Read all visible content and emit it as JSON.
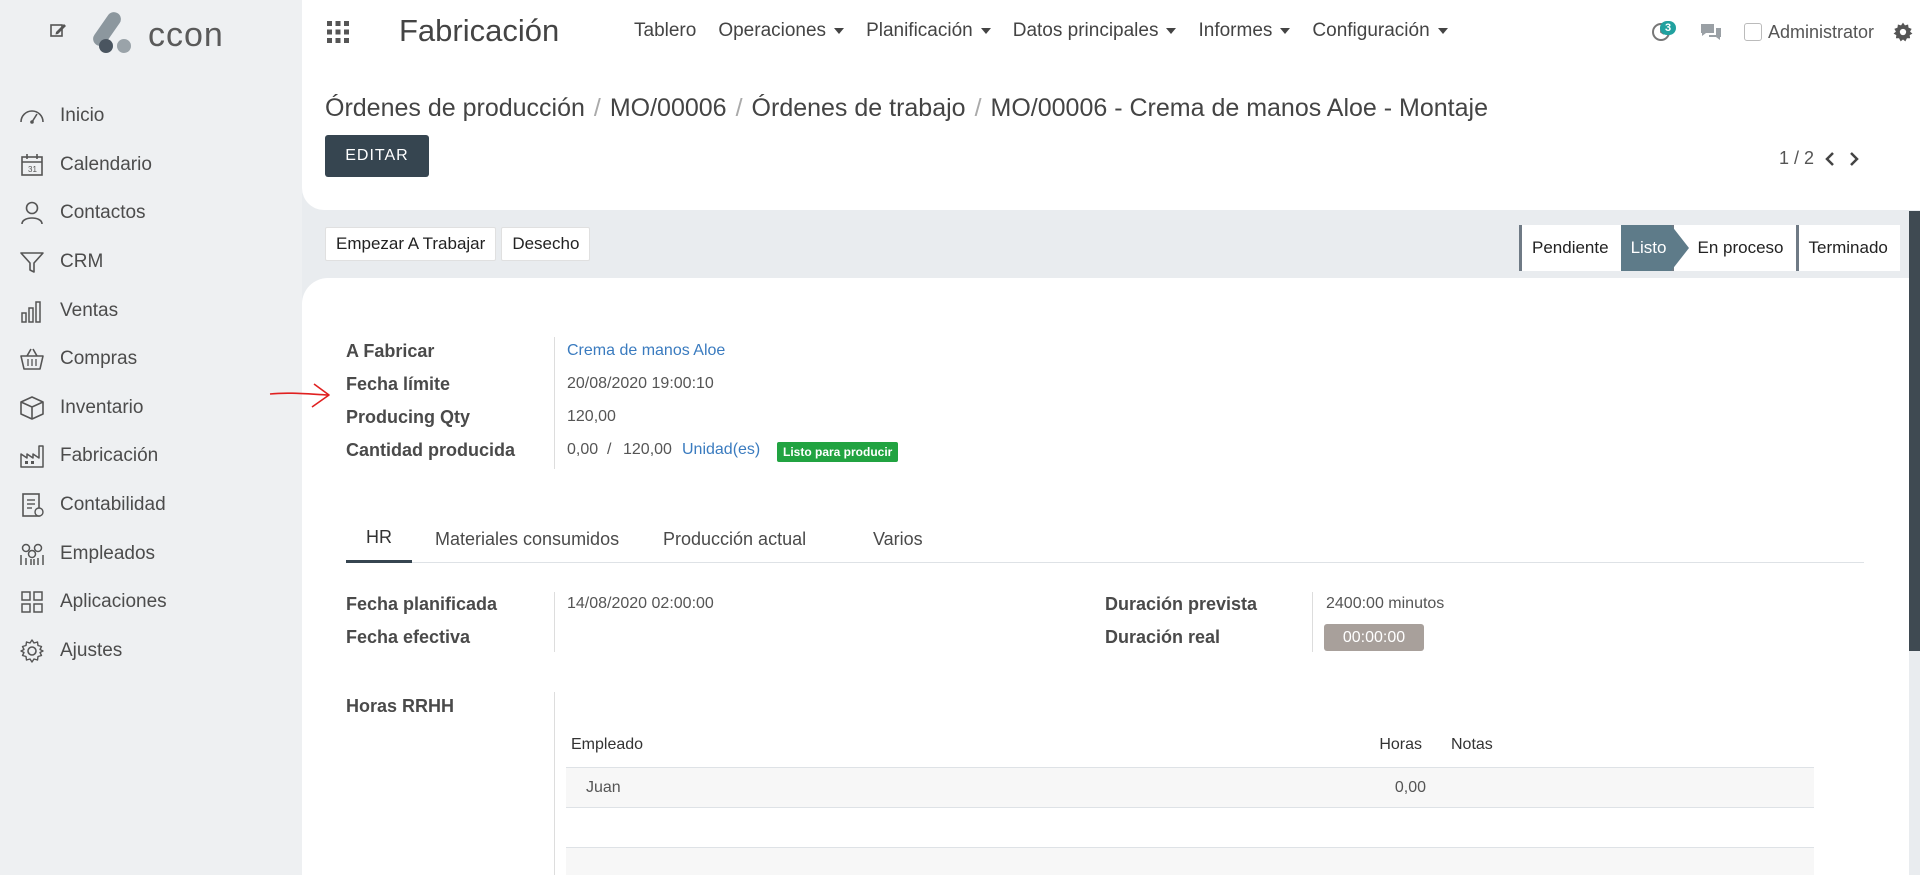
{
  "brand": {
    "logo_text": "ccon"
  },
  "sidebar": {
    "items": [
      {
        "label": "Inicio",
        "icon": "dashboard-gauge-icon"
      },
      {
        "label": "Calendario",
        "icon": "calendar-icon"
      },
      {
        "label": "Contactos",
        "icon": "person-icon"
      },
      {
        "label": "CRM",
        "icon": "funnel-icon"
      },
      {
        "label": "Ventas",
        "icon": "bar-chart-icon"
      },
      {
        "label": "Compras",
        "icon": "basket-icon"
      },
      {
        "label": "Inventario",
        "icon": "box-icon"
      },
      {
        "label": "Fabricación",
        "icon": "factory-icon"
      },
      {
        "label": "Contabilidad",
        "icon": "invoice-icon"
      },
      {
        "label": "Empleados",
        "icon": "people-icon"
      },
      {
        "label": "Aplicaciones",
        "icon": "apps-grid-icon"
      },
      {
        "label": "Ajustes",
        "icon": "gear-icon"
      }
    ]
  },
  "topbar": {
    "app_title": "Fabricación",
    "nav": [
      {
        "label": "Tablero",
        "dropdown": false
      },
      {
        "label": "Operaciones",
        "dropdown": true
      },
      {
        "label": "Planificación",
        "dropdown": true
      },
      {
        "label": "Datos principales",
        "dropdown": true
      },
      {
        "label": "Informes",
        "dropdown": true
      },
      {
        "label": "Configuración",
        "dropdown": true
      }
    ],
    "activity_count": "3",
    "user_name": "Administrator"
  },
  "control": {
    "breadcrumbs": [
      "Órdenes de producción",
      "MO/00006",
      "Órdenes de trabajo"
    ],
    "current": "MO/00006 - Crema de manos Aloe - Montaje",
    "edit_label": "EDITAR",
    "pager": "1 / 2"
  },
  "actions": {
    "start": "Empezar A Trabajar",
    "scrap": "Desecho"
  },
  "stages": [
    {
      "label": "Pendiente",
      "active": false
    },
    {
      "label": "Listo",
      "active": true
    },
    {
      "label": "En proceso",
      "active": false
    },
    {
      "label": "Terminado",
      "active": false
    }
  ],
  "form": {
    "to_produce_label": "A Fabricar",
    "to_produce_value": "Crema de manos Aloe",
    "deadline_label": "Fecha límite",
    "deadline_value": "20/08/2020 19:00:10",
    "producing_qty_label": "Producing Qty",
    "producing_qty_value": "120,00",
    "produced_label": "Cantidad producida",
    "produced_value": "0,00",
    "produced_sep": "/",
    "produced_total": "120,00",
    "uom": "Unidad(es)",
    "ready_badge": "Listo para producir"
  },
  "tabs": [
    "HR",
    "Materiales consumidos",
    "Producción actual",
    "Varios"
  ],
  "hr": {
    "planned_date_label": "Fecha planificada",
    "planned_date_value": "14/08/2020 02:00:00",
    "effective_date_label": "Fecha efectiva",
    "expected_duration_label": "Duración prevista",
    "expected_duration_value": "2400:00 minutos",
    "real_duration_label": "Duración real",
    "real_duration_value": "00:00:00",
    "hours_label": "Horas RRHH",
    "table": {
      "headers": [
        "Empleado",
        "Horas",
        "Notas"
      ],
      "rows": [
        {
          "employee": "Juan",
          "hours": "0,00",
          "notes": ""
        }
      ]
    }
  },
  "colors": {
    "primary": "#364550",
    "stage_active": "#5e7b89",
    "ready": "#21a341",
    "link": "#3a7bbf",
    "annotation_arrow": "#e02020"
  }
}
